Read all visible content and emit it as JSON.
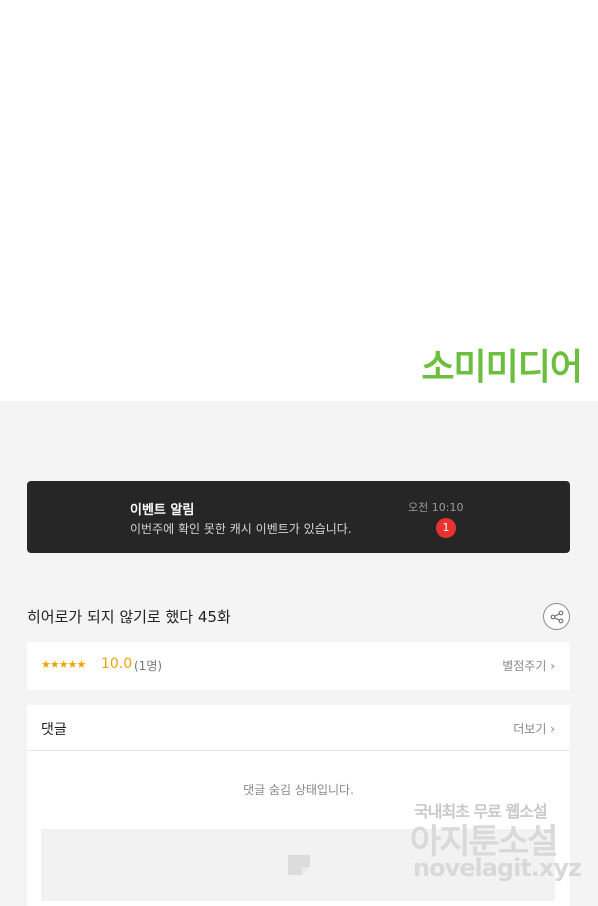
{
  "publisher": {
    "logo_text": "소미미디어",
    "logo_color": "#6cbf3c"
  },
  "event": {
    "title": "이벤트 알림",
    "message": "이번주에 확인 못한 캐시 이벤트가 있습니다.",
    "time": "오전 10:10",
    "badge_count": "1",
    "badge_color": "#e8322f"
  },
  "episode": {
    "title": "히어로가 되지 않기로 했다 45화",
    "share_icon": "share-icon"
  },
  "rating": {
    "stars": "★★★★★",
    "score": "10.0",
    "count": "(1명)",
    "rate_label": "별점주기 ›",
    "accent_color": "#f0a30a"
  },
  "comments": {
    "title": "댓글",
    "more_label": "더보기 ›",
    "hidden_notice": "댓글 숨김 상태입니다."
  },
  "watermark": {
    "line1": "국내최초 무료 웹소설",
    "line2": "아지툰소설",
    "line3": "novelagit.xyz"
  }
}
